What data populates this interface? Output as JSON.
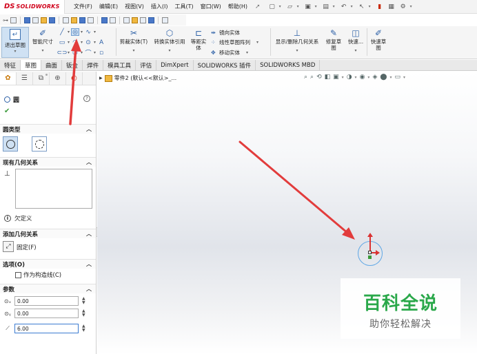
{
  "app": {
    "logo_mark": "DS",
    "logo_text": "SOLIDWORKS"
  },
  "menu": [
    "文件(F)",
    "编辑(E)",
    "视图(V)",
    "插入(I)",
    "工具(T)",
    "窗口(W)",
    "帮助(H)"
  ],
  "ribbon": {
    "exit_sketch": "退出草图",
    "smart_dimension": "智能尺寸",
    "trim": "剪裁实体(T)",
    "convert": "转换实体引用",
    "offset": [
      "等距实",
      "体"
    ],
    "mirror": "镜向实体",
    "linear_pattern": "线性草图阵列",
    "move": "移动实体",
    "display_relations": "显示/删除几何关系",
    "repair": [
      "修复草",
      "图"
    ],
    "quick_snap": "快速...",
    "rapid_sketch": [
      "快速草",
      "图"
    ]
  },
  "tabs": [
    "特征",
    "草图",
    "曲面",
    "钣金",
    "焊件",
    "模具工具",
    "评估",
    "DimXpert",
    "SOLIDWORKS 插件",
    "SOLIDWORKS MBD"
  ],
  "active_tab": "草图",
  "property_manager": {
    "title": "圆",
    "help": "?",
    "ok": "✔",
    "circle_type": {
      "heading": "圆类型"
    },
    "existing_relations": {
      "heading": "现有几何关系"
    },
    "status": {
      "icon": "i",
      "text": "欠定义"
    },
    "add_relations": {
      "heading": "添加几何关系",
      "fix_label": "固定(F)"
    },
    "options": {
      "heading": "选项(O)",
      "construction_label": "作为构造线(C)"
    },
    "parameters": {
      "heading": "参数",
      "cx": "0.00",
      "cy": "0.00",
      "radius": "6.00"
    }
  },
  "graphics": {
    "tree_label": "零件2 (默认<<默认>_..."
  },
  "watermark": {
    "main": "百科全说",
    "sub": "助你轻松解决"
  },
  "colors": {
    "accent": "#d0021b",
    "selection": "#cfe1f3",
    "annotation_arrow": "#e23c3c",
    "sketch": "#5ea7e6",
    "watermark": "#2aa84a"
  }
}
